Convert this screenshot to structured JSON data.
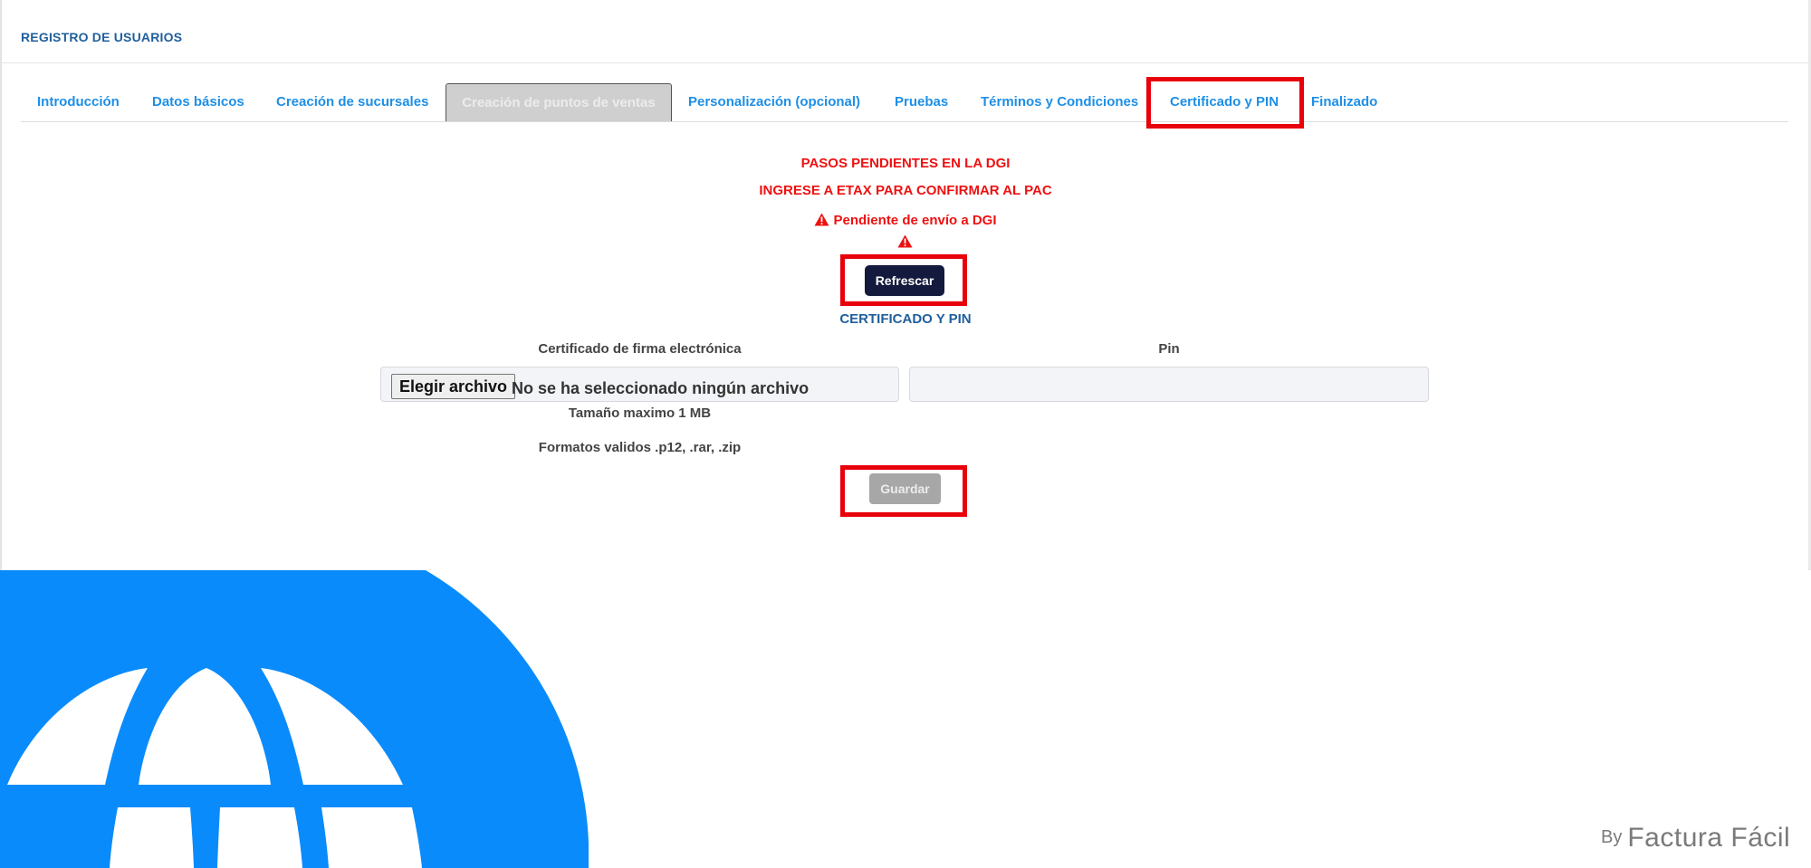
{
  "header": {
    "title": "REGISTRO DE USUARIOS"
  },
  "tabs": [
    {
      "label": "Introducción"
    },
    {
      "label": "Datos básicos"
    },
    {
      "label": "Creación de sucursales"
    },
    {
      "label": "Creación de puntos de ventas"
    },
    {
      "label": "Personalización (opcional)"
    },
    {
      "label": "Pruebas"
    },
    {
      "label": "Términos y Condiciones"
    },
    {
      "label": "Certificado y PIN"
    },
    {
      "label": "Finalizado"
    }
  ],
  "status": {
    "pending_dgi": "PASOS PENDIENTES EN LA DGI",
    "etax_confirm": "INGRESE A ETAX PARA CONFIRMAR AL PAC",
    "pending_send": "Pendiente de envío a DGI"
  },
  "refresh_label": "Refrescar",
  "section_title": "CERTIFICADO Y PIN",
  "form": {
    "certificate_label": "Certificado de firma electrónica",
    "pin_label": "Pin",
    "file_button": "Elegir archivo",
    "file_status": "No se ha seleccionado ningún archivo",
    "pin_value": "",
    "max_size": "Tamaño maximo 1 MB",
    "formats": "Formatos validos .p12, .rar, .zip",
    "save_label": "Guardar"
  },
  "brand": {
    "by": "By",
    "name": "Factura Fácil"
  },
  "colors": {
    "accent_blue": "#1e8fe6",
    "dark_blue": "#1f5f9c",
    "warning_red": "#ee1111",
    "highlight_red": "#e8000b",
    "globe_blue": "#0a8bfb",
    "refresh_button": "#141a3d"
  }
}
